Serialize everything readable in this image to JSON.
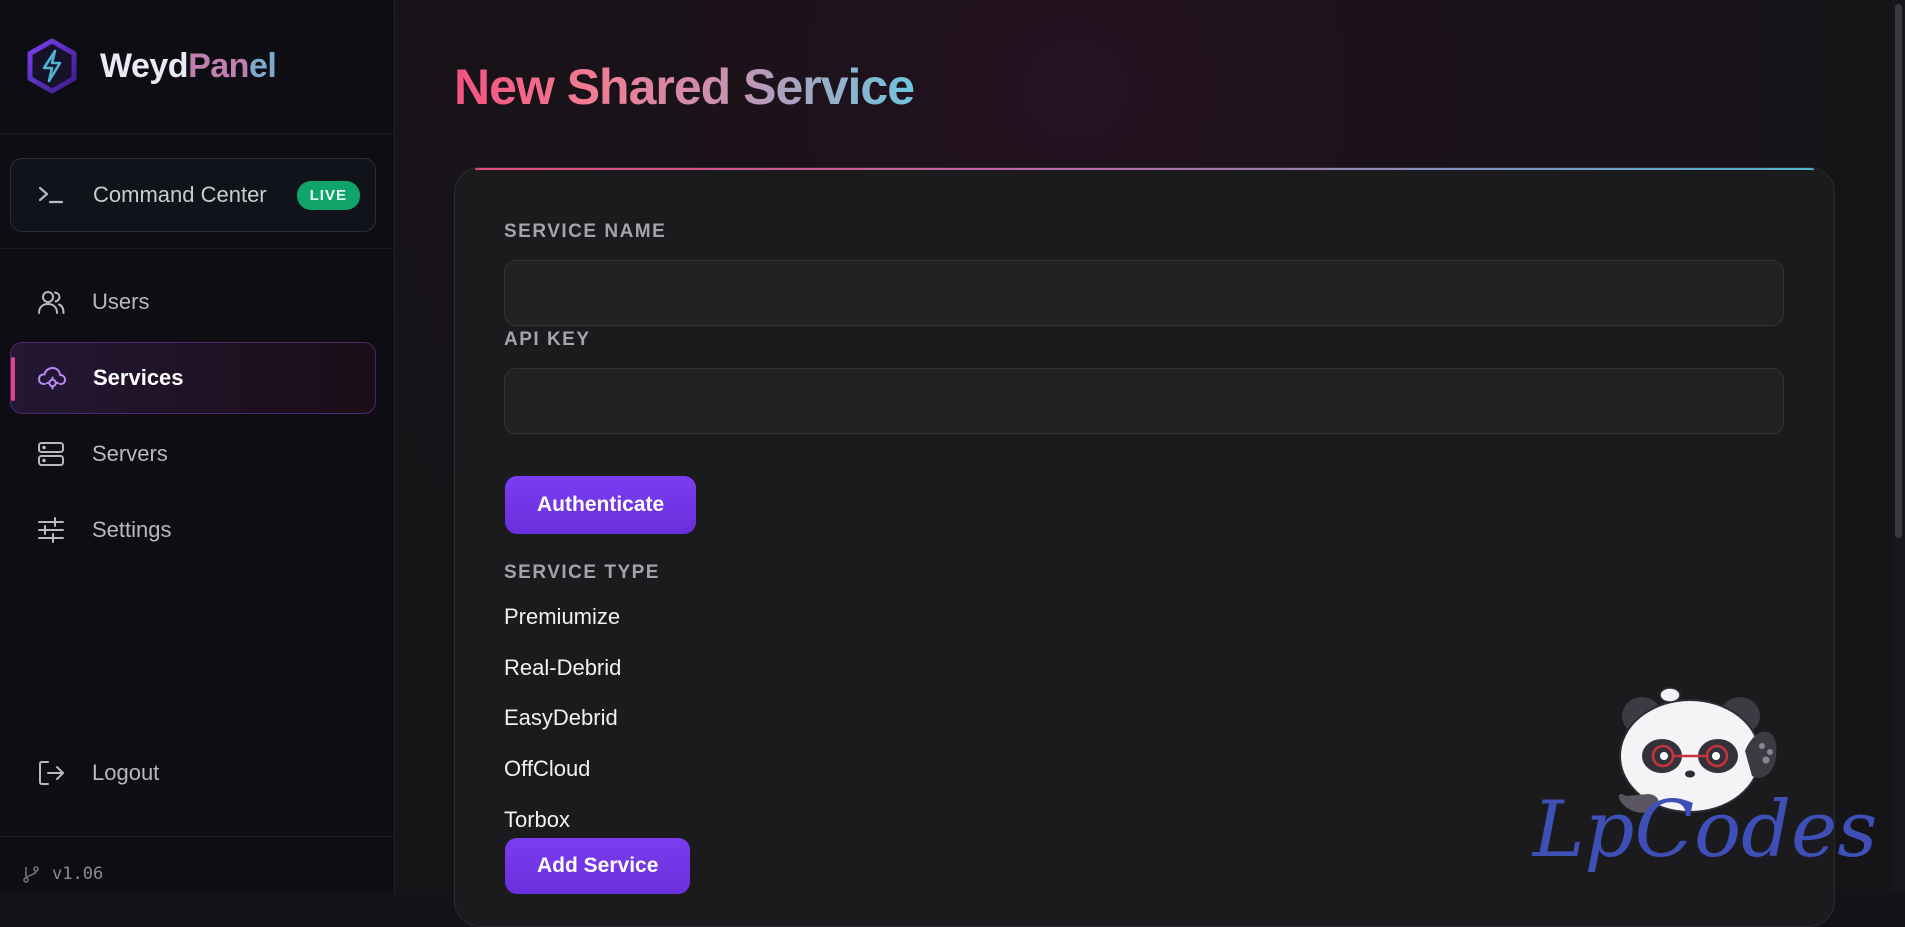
{
  "app": {
    "brand_part1": "Weyd",
    "brand_part2": "Pan",
    "brand_part3": "el",
    "version": "v1.06"
  },
  "sidebar": {
    "command_center": {
      "label": "Command Center",
      "badge": "LIVE"
    },
    "items": [
      {
        "label": "Users",
        "icon": "users-icon"
      },
      {
        "label": "Services",
        "icon": "cloud-gear-icon",
        "active": true
      },
      {
        "label": "Servers",
        "icon": "server-icon"
      },
      {
        "label": "Settings",
        "icon": "sliders-icon"
      }
    ],
    "logout": "Logout"
  },
  "page": {
    "title": "New Shared Service"
  },
  "form": {
    "service_name": {
      "label": "SERVICE NAME",
      "value": "",
      "placeholder": ""
    },
    "api_key": {
      "label": "API KEY",
      "value": "",
      "placeholder": ""
    },
    "authenticate_label": "Authenticate",
    "service_type": {
      "label": "SERVICE TYPE",
      "options": [
        "Premiumize",
        "Real-Debrid",
        "EasyDebrid",
        "OffCloud",
        "Torbox"
      ]
    },
    "submit_label": "Add Service"
  },
  "watermark": {
    "text": "LpCodes"
  },
  "colors": {
    "accent_purple": "#7b3df0",
    "live_green": "#10a36a",
    "active_indicator": "#e0428c",
    "title_gradient": [
      "#f2527f",
      "#c792b0",
      "#6ec6dd"
    ]
  }
}
